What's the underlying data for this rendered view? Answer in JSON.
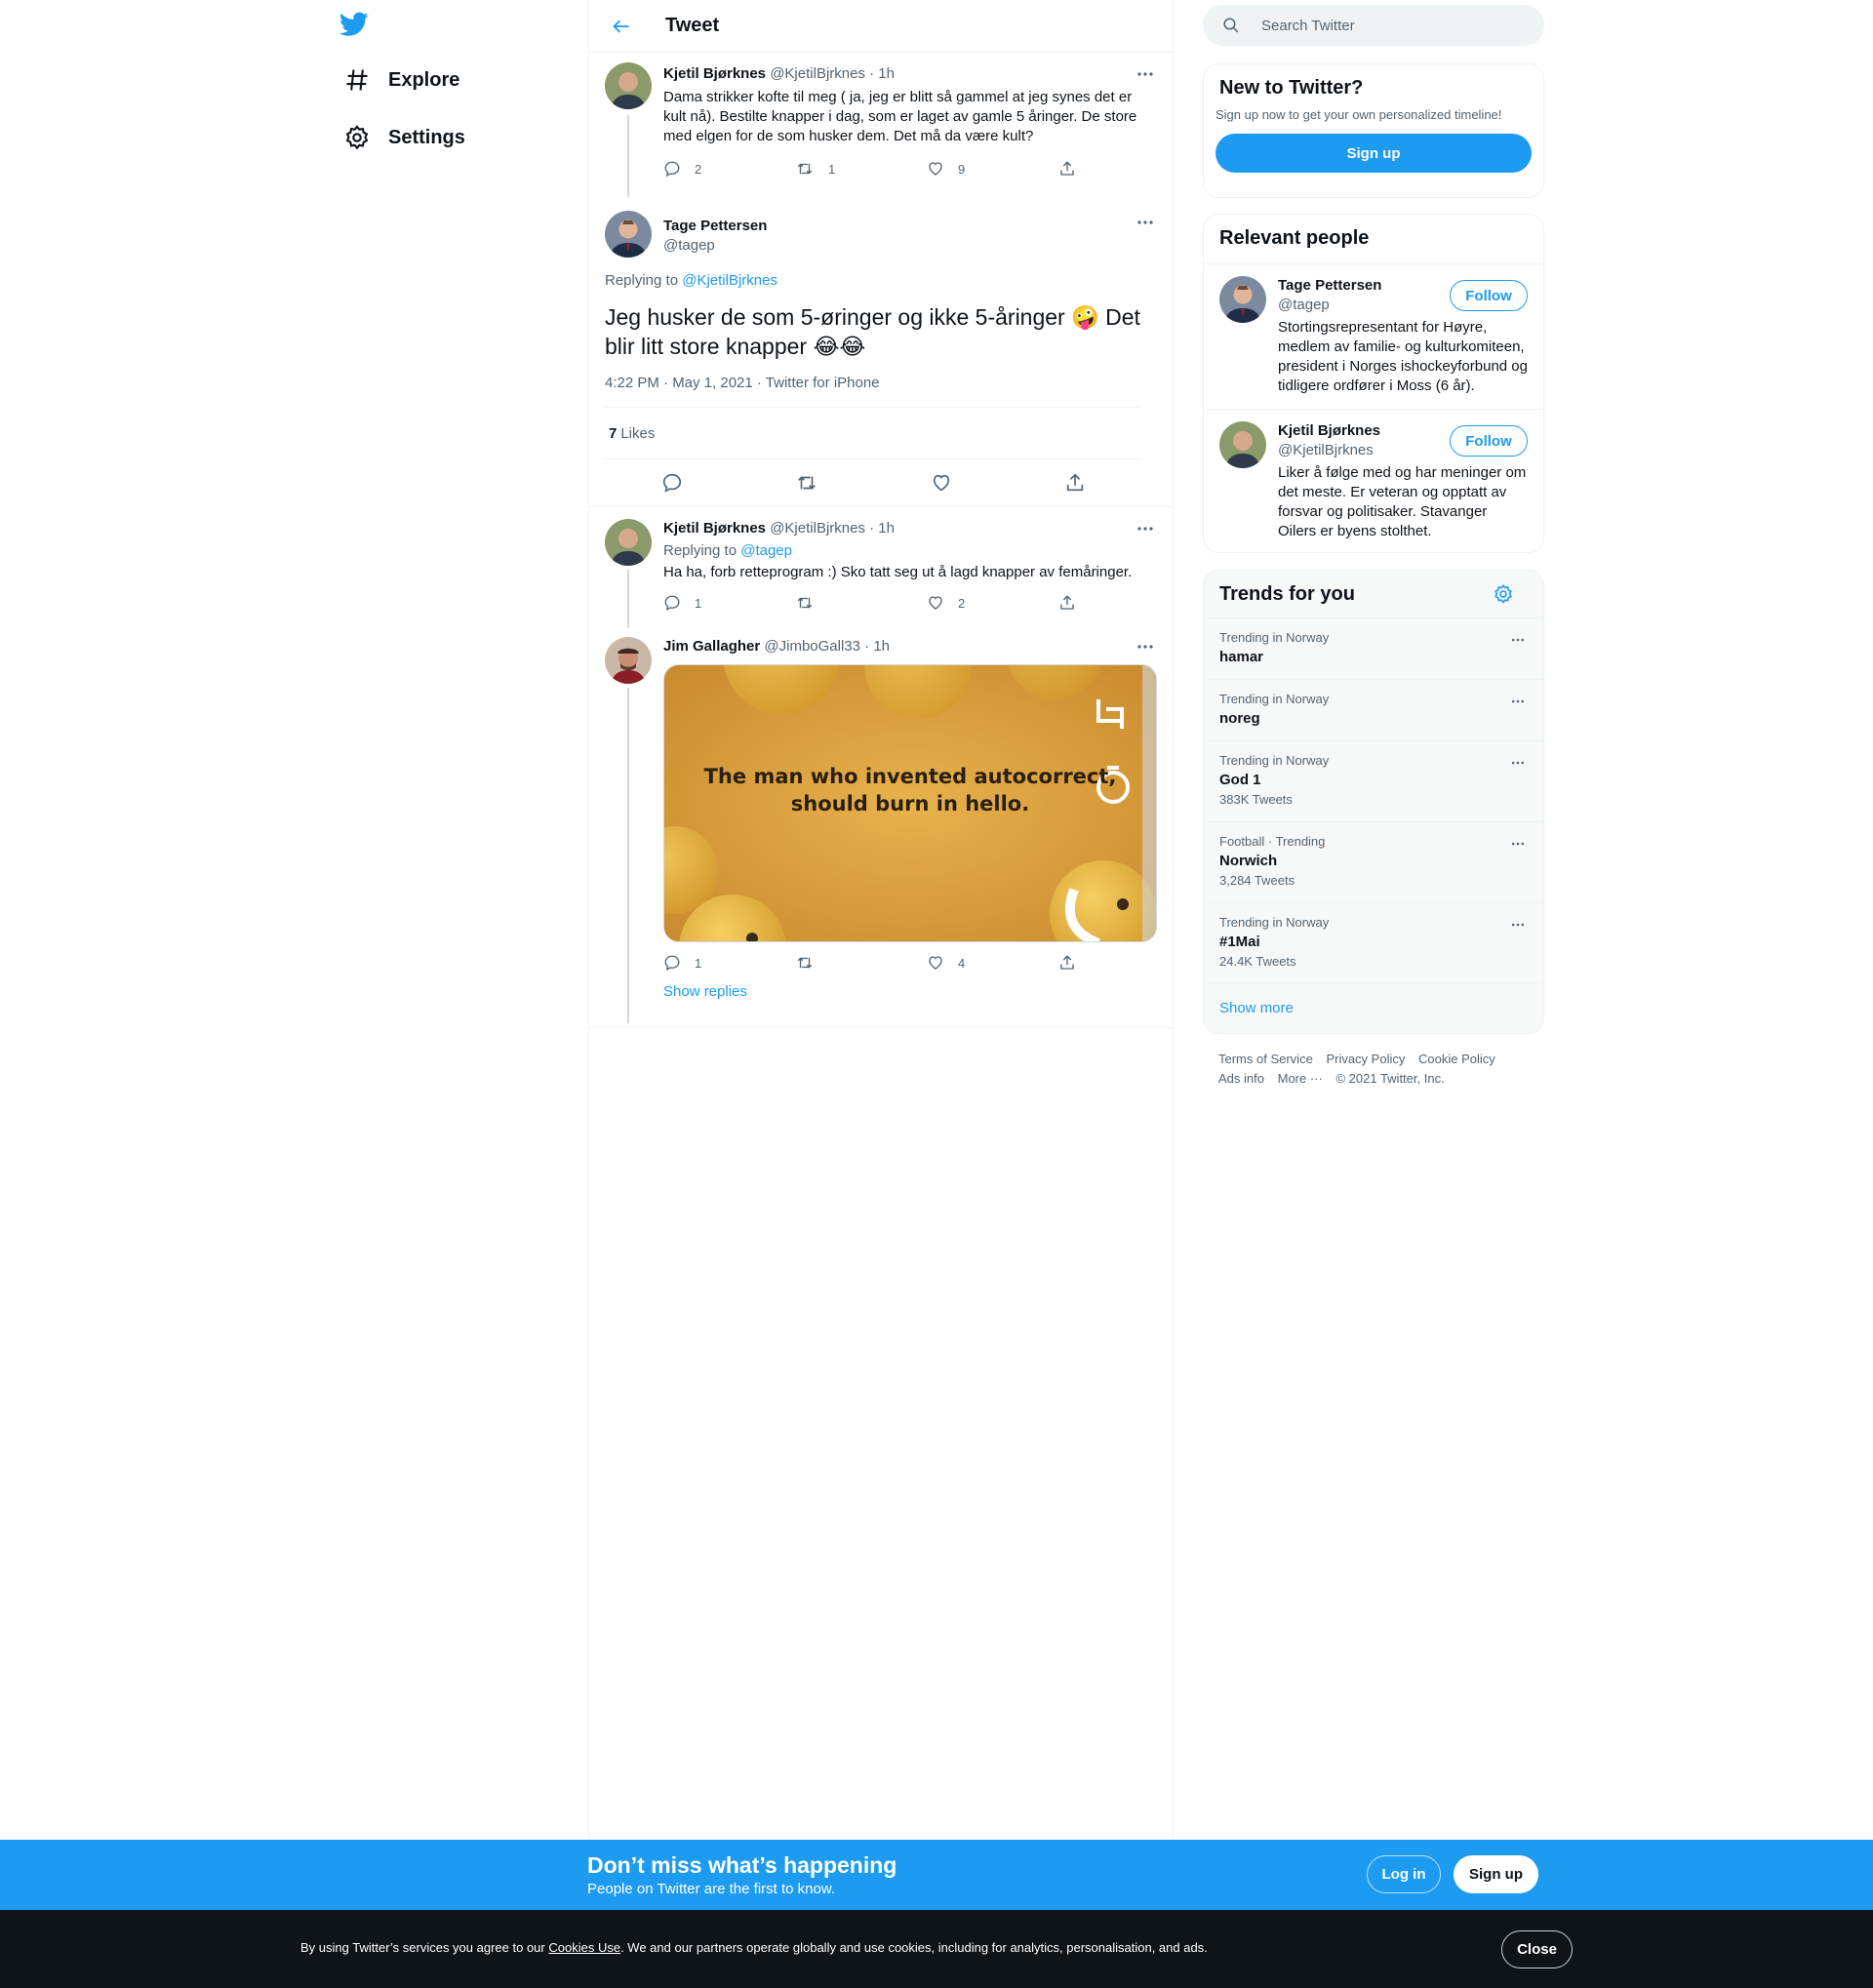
{
  "nav": {
    "logo_icon": "twitter-bird-icon",
    "items": [
      {
        "label": "Explore",
        "icon": "hashtag-icon"
      },
      {
        "label": "Settings",
        "icon": "gear-icon"
      }
    ]
  },
  "header": {
    "title": "Tweet",
    "back_icon": "back-arrow-icon"
  },
  "thread": {
    "parent": {
      "name": "Kjetil Bjørknes",
      "handle": "@KjetilBjrknes",
      "time": "· 1h",
      "text": "Dama strikker kofte til meg ( ja, jeg er blitt så gammel at jeg synes det er kult nå). Bestilte knapper i dag, som er laget av gamle 5 åringer. De store med elgen for de som husker dem. Det må da være kult?",
      "replies": "2",
      "retweets": "1",
      "likes": "9"
    },
    "focus": {
      "name": "Tage Pettersen",
      "handle": "@tagep",
      "replying_prefix": "Replying to",
      "replying_to": "@KjetilBjrknes",
      "text": "Jeg husker de som 5-øringer og ikke 5-åringer 🤪 Det blir litt store knapper 😂😂",
      "meta": "4:22 PM · May 1, 2021 · Twitter for iPhone",
      "likes_count": "7",
      "likes_label": "Likes"
    },
    "replies": [
      {
        "name": "Kjetil Bjørknes",
        "handle": "@KjetilBjrknes",
        "time": "· 1h",
        "replying_prefix": "Replying to",
        "replying_to": "@tagep",
        "text": "Ha ha, forb retteprogram :) Sko tatt seg ut å lagd knapper av femåringer.",
        "replies": "1",
        "retweets": "",
        "likes": "2"
      },
      {
        "name": "Jim Gallagher",
        "handle": "@JimboGall33",
        "time": "· 1h",
        "media_text_line1": "The man who invented autocorrect,",
        "media_text_line2": "should burn in hello.",
        "replies": "1",
        "retweets": "",
        "likes": "4"
      }
    ],
    "show_replies": "Show replies"
  },
  "search": {
    "placeholder": "Search Twitter"
  },
  "new_to_twitter": {
    "title": "New to Twitter?",
    "subtitle": "Sign up now to get your own personalized timeline!",
    "button": "Sign up"
  },
  "relevant_people": {
    "title": "Relevant people",
    "people": [
      {
        "name": "Tage Pettersen",
        "handle": "@tagep",
        "bio": "Stortingsrepresentant for Høyre, medlem av familie- og kulturkomiteen, president i Norges ishockeyforbund og tidligere ordfører i Moss (6 år).",
        "follow": "Follow"
      },
      {
        "name": "Kjetil Bjørknes",
        "handle": "@KjetilBjrknes",
        "bio": "Liker å følge med og har meninger om det meste. Er veteran og opptatt av forsvar og politisaker. Stavanger Oilers er byens stolthet.",
        "follow": "Follow"
      }
    ]
  },
  "trends": {
    "title": "Trends for you",
    "items": [
      {
        "context": "Trending in Norway",
        "name": "hamar",
        "count": ""
      },
      {
        "context": "Trending in Norway",
        "name": "noreg",
        "count": ""
      },
      {
        "context": "Trending in Norway",
        "name": "God 1",
        "count": "383K Tweets"
      },
      {
        "context": "Football · Trending",
        "name": "Norwich",
        "count": "3,284 Tweets"
      },
      {
        "context": "Trending in Norway",
        "name": "#1Mai",
        "count": "24.4K Tweets"
      }
    ],
    "show_more": "Show more"
  },
  "footer": {
    "links": [
      "Terms of Service",
      "Privacy Policy",
      "Cookie Policy",
      "Ads info",
      "More ···"
    ],
    "copyright": "© 2021 Twitter, Inc."
  },
  "promo": {
    "title": "Don’t miss what’s happening",
    "subtitle": "People on Twitter are the first to know.",
    "login": "Log in",
    "signup": "Sign up"
  },
  "cookie": {
    "text_before": "By using Twitter’s services you agree to our ",
    "link": "Cookies Use",
    "text_after": ". We and our partners operate globally and use cookies, including for analytics, personalisation, and ads.",
    "close": "Close"
  },
  "colors": {
    "accent": "#1d9bf0",
    "text": "#0f1419",
    "muted": "#536471",
    "border": "#eff3f4",
    "cookie_bg": "#0f1419"
  }
}
